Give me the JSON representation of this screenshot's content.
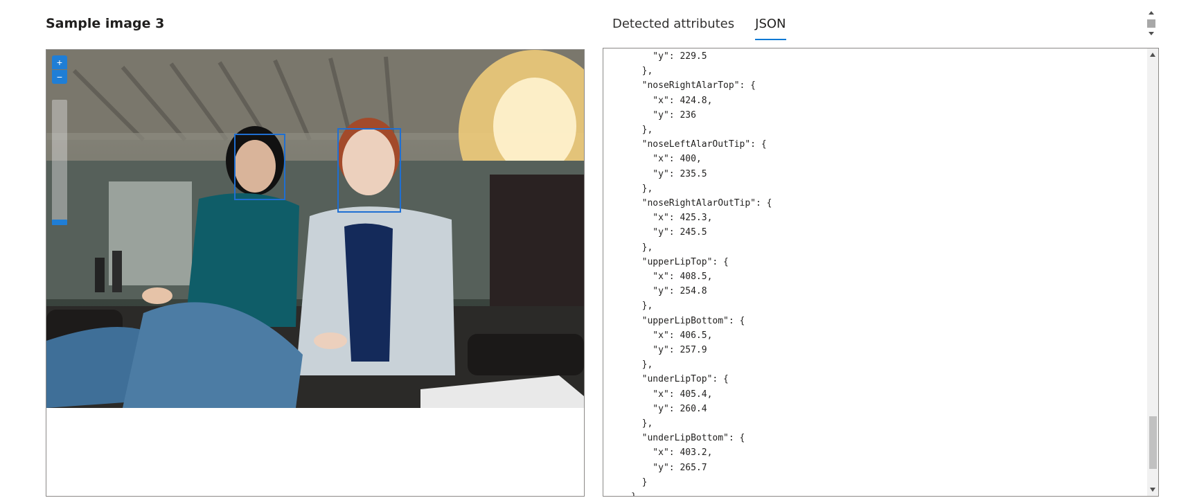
{
  "sample": {
    "title": "Sample image 3"
  },
  "tabs": [
    {
      "label": "Detected attributes",
      "active": false
    },
    {
      "label": "JSON",
      "active": true
    }
  ],
  "colors": {
    "accent": "#0078d4",
    "face_box": "#1f6fd2"
  },
  "viewer": {
    "zoom_in_icon": "plus-icon",
    "zoom_out_icon": "minus-icon",
    "face_count": 2
  },
  "json_lines": [
    "    \"y\": 229.5",
    "  },",
    "  \"noseRightAlarTop\": {",
    "    \"x\": 424.8,",
    "    \"y\": 236",
    "  },",
    "  \"noseLeftAlarOutTip\": {",
    "    \"x\": 400,",
    "    \"y\": 235.5",
    "  },",
    "  \"noseRightAlarOutTip\": {",
    "    \"x\": 425.3,",
    "    \"y\": 245.5",
    "  },",
    "  \"upperLipTop\": {",
    "    \"x\": 408.5,",
    "    \"y\": 254.8",
    "  },",
    "  \"upperLipBottom\": {",
    "    \"x\": 406.5,",
    "    \"y\": 257.9",
    "  },",
    "  \"underLipTop\": {",
    "    \"x\": 405.4,",
    "    \"y\": 260.4",
    "  },",
    "  \"underLipBottom\": {",
    "    \"x\": 403.2,",
    "    \"y\": 265.7",
    "  }",
    "}"
  ]
}
